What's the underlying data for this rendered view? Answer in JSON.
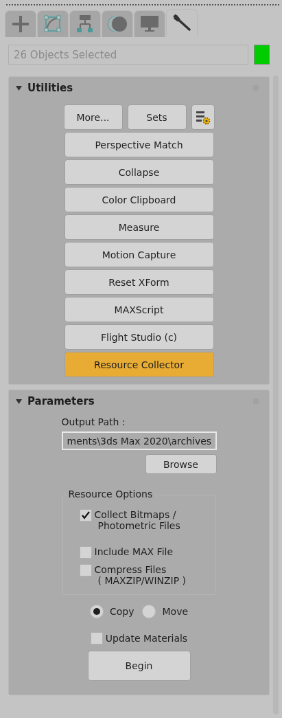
{
  "tabs": [
    {
      "kind": "create",
      "selected": false
    },
    {
      "kind": "modify",
      "selected": false
    },
    {
      "kind": "hierarchy",
      "selected": false
    },
    {
      "kind": "motion",
      "selected": false
    },
    {
      "kind": "display",
      "selected": false
    },
    {
      "kind": "utilities",
      "selected": true
    }
  ],
  "selection": {
    "value": "26 Objects Selected",
    "color": "#00cc00"
  },
  "utilities": {
    "title": "Utilities",
    "expanded": true,
    "top_buttons": [
      "More...",
      "Sets"
    ],
    "buttons": [
      {
        "label": "Perspective Match",
        "selected": false
      },
      {
        "label": "Collapse",
        "selected": false
      },
      {
        "label": "Color Clipboard",
        "selected": false
      },
      {
        "label": "Measure",
        "selected": false
      },
      {
        "label": "Motion Capture",
        "selected": false
      },
      {
        "label": "Reset XForm",
        "selected": false
      },
      {
        "label": "MAXScript",
        "selected": false
      },
      {
        "label": "Flight Studio (c)",
        "selected": false
      },
      {
        "label": "Resource Collector",
        "selected": true
      }
    ]
  },
  "parameters": {
    "title": "Parameters",
    "expanded": true,
    "output_path_label": "Output Path :",
    "output_path": "ments\\3ds Max 2020\\archives",
    "browse": "Browse",
    "group_title": "Resource Options",
    "options": [
      {
        "label": "Collect Bitmaps /",
        "label_2": "Photometric Files",
        "checked": true
      },
      {
        "label": "Include MAX File",
        "checked": false
      },
      {
        "label": "Compress Files",
        "label_2": "( MAXZIP/WINZIP )",
        "checked": false
      }
    ],
    "mode": [
      {
        "label": "Copy",
        "selected": true
      },
      {
        "label": "Move",
        "selected": false
      }
    ],
    "update_materials": {
      "label": "Update Materials",
      "checked": false
    },
    "begin": "Begin"
  }
}
